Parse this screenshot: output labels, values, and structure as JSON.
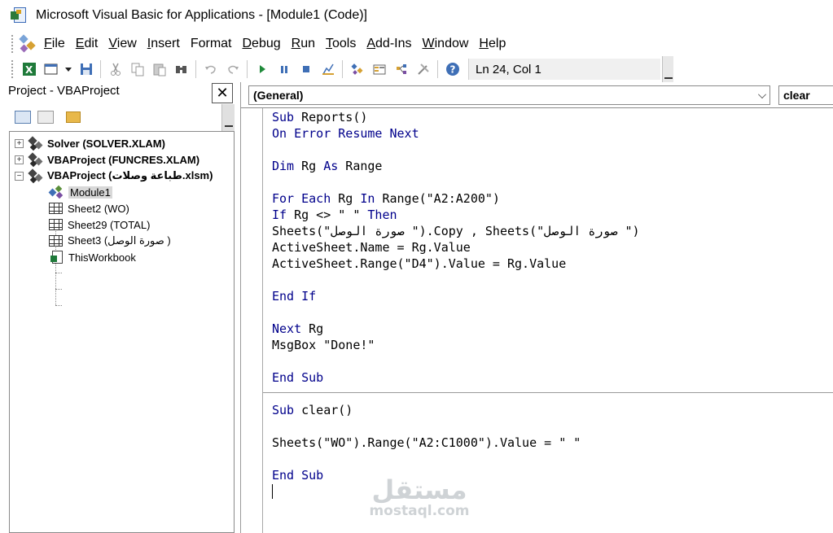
{
  "window": {
    "title": "Microsoft Visual Basic for Applications - [Module1 (Code)]"
  },
  "menu": [
    {
      "accel": "F",
      "rest": "ile"
    },
    {
      "accel": "E",
      "rest": "dit"
    },
    {
      "accel": "V",
      "rest": "iew"
    },
    {
      "accel": "I",
      "rest": "nsert"
    },
    {
      "accel": "",
      "rest": "Format"
    },
    {
      "accel": "D",
      "rest": "ebug"
    },
    {
      "accel": "R",
      "rest": "un"
    },
    {
      "accel": "T",
      "rest": "ools"
    },
    {
      "accel": "A",
      "rest": "dd-Ins"
    },
    {
      "accel": "W",
      "rest": "indow"
    },
    {
      "accel": "H",
      "rest": "elp"
    }
  ],
  "toolbar": {
    "cursor_position": "Ln 24, Col 1"
  },
  "project": {
    "title": "Project - VBAProject",
    "close_glyph": "✕",
    "projects": [
      {
        "label": "Solver (SOLVER.XLAM)",
        "expander": "+"
      },
      {
        "label": "VBAProject (FUNCRES.XLAM)",
        "expander": "+"
      },
      {
        "label": "VBAProject (طباعة وصلات.xlsm)",
        "expander": "−"
      }
    ],
    "items": [
      {
        "label": "Module1",
        "type": "module"
      },
      {
        "label": "Sheet2 (WO)",
        "type": "sheet"
      },
      {
        "label": "Sheet29 (TOTAL)",
        "type": "sheet"
      },
      {
        "label": "Sheet3 (صورة الوصل )",
        "type": "sheet"
      },
      {
        "label": "ThisWorkbook",
        "type": "workbook"
      }
    ]
  },
  "code": {
    "object_combo": "(General)",
    "proc_combo": "clear",
    "lines": [
      [
        [
          "kw",
          "Sub"
        ],
        [
          "t",
          " Reports()"
        ]
      ],
      [
        [
          "kw",
          "On Error Resume Next"
        ]
      ],
      [],
      [
        [
          "kw",
          "Dim"
        ],
        [
          "t",
          " Rg "
        ],
        [
          "kw",
          "As"
        ],
        [
          "t",
          " Range"
        ]
      ],
      [],
      [
        [
          "kw",
          "For Each"
        ],
        [
          "t",
          " Rg "
        ],
        [
          "kw",
          "In"
        ],
        [
          "t",
          " Range(\"A2:A200\")"
        ]
      ],
      [
        [
          "kw",
          "If"
        ],
        [
          "t",
          " Rg <> \" \" "
        ],
        [
          "kw",
          "Then"
        ]
      ],
      [
        [
          "t",
          "Sheets(\"صورة الوصل \").Copy , Sheets(\"صورة الوصل \")"
        ]
      ],
      [
        [
          "t",
          "ActiveSheet.Name = Rg.Value"
        ]
      ],
      [
        [
          "t",
          "ActiveSheet.Range(\"D4\").Value = Rg.Value"
        ]
      ],
      [],
      [
        [
          "kw",
          "End If"
        ]
      ],
      [],
      [
        [
          "kw",
          "Next"
        ],
        [
          "t",
          " Rg"
        ]
      ],
      [
        [
          "t",
          "MsgBox \"Done!\""
        ]
      ],
      [],
      [
        [
          "kw",
          "End Sub"
        ]
      ],
      [],
      [
        [
          "kw",
          "Sub"
        ],
        [
          "t",
          " clear()"
        ]
      ],
      [],
      [
        [
          "t",
          "Sheets(\"WO\").Range(\"A2:C1000\").Value = \" \""
        ]
      ],
      [],
      [
        [
          "kw",
          "End Sub"
        ]
      ]
    ]
  },
  "watermark": {
    "arabic": "مستقل",
    "latin": "mostaql.com"
  }
}
